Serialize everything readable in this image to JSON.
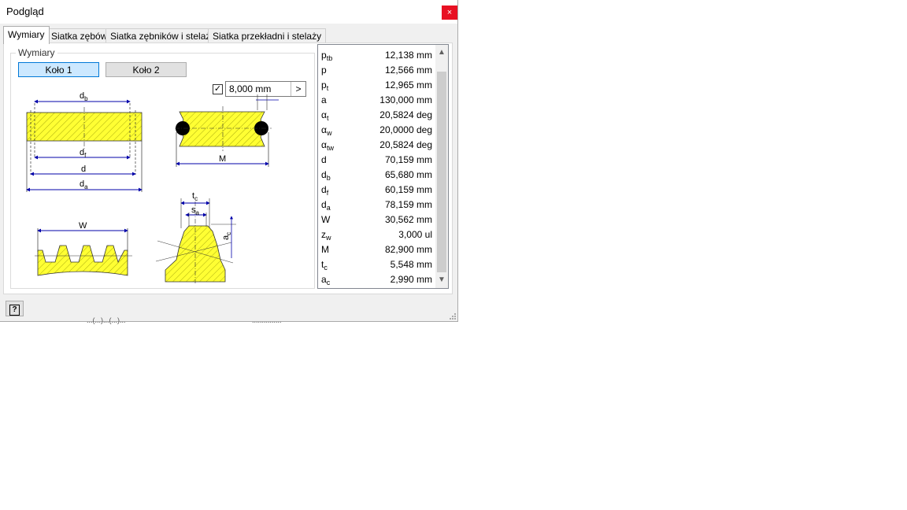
{
  "window": {
    "title": "Podgląd",
    "close_label": "×"
  },
  "tabs": [
    {
      "label": "Wymiary",
      "active": true
    },
    {
      "label": "Siatka zębów"
    },
    {
      "label": "Siatka zębników i stelaży"
    },
    {
      "label": "Siatka przekładni i stelaży"
    }
  ],
  "group": {
    "label": "Wymiary",
    "buttons": {
      "kolo1": "Koło 1",
      "kolo2": "Koło 2"
    },
    "checkbox_checked": true,
    "checkbox_mark": "✓",
    "input_value": "8,000 mm",
    "input_arrow": ">"
  },
  "diagram_labels": {
    "db": "d",
    "db_sub": "b",
    "df": "d",
    "df_sub": "f",
    "d": "d",
    "da": "d",
    "da_sub": "a",
    "M": "M",
    "W": "W",
    "tc": "t",
    "tc_sub": "c",
    "sa": "s",
    "sa_sub": "a",
    "ac": "a",
    "ac_sub": "c"
  },
  "values": [
    {
      "sym": "p",
      "sub": "tb",
      "value": "12,138 mm"
    },
    {
      "sym": "p",
      "sub": "",
      "value": "12,566 mm"
    },
    {
      "sym": "p",
      "sub": "t",
      "value": "12,965 mm"
    },
    {
      "sym": "a",
      "sub": "",
      "value": "130,000 mm"
    },
    {
      "sym": "α",
      "sub": "t",
      "value": "20,5824 deg"
    },
    {
      "sym": "α",
      "sub": "w",
      "value": "20,0000 deg"
    },
    {
      "sym": "α",
      "sub": "tw",
      "value": "20,5824 deg"
    },
    {
      "sym": "d",
      "sub": "",
      "value": "70,159 mm"
    },
    {
      "sym": "d",
      "sub": "b",
      "value": "65,680 mm"
    },
    {
      "sym": "d",
      "sub": "f",
      "value": "60,159 mm"
    },
    {
      "sym": "d",
      "sub": "a",
      "value": "78,159 mm"
    },
    {
      "sym": "W",
      "sub": "",
      "value": "30,562 mm"
    },
    {
      "sym": "z",
      "sub": "w",
      "value": "3,000 ul"
    },
    {
      "sym": "M",
      "sub": "",
      "value": "82,900 mm"
    },
    {
      "sym": "t",
      "sub": "c",
      "value": "5,548 mm"
    },
    {
      "sym": "a",
      "sub": "c",
      "value": "2,990 mm"
    }
  ],
  "scroll": {
    "up": "▲",
    "down": "▼"
  },
  "help": {
    "label": "?"
  },
  "background_text": {
    "left": "...(...)...(...)...",
    "right": "..............."
  },
  "colors": {
    "fill": "#ffff33",
    "dimension": "#0000aa",
    "accent": "#0078d7",
    "close": "#e81123"
  }
}
